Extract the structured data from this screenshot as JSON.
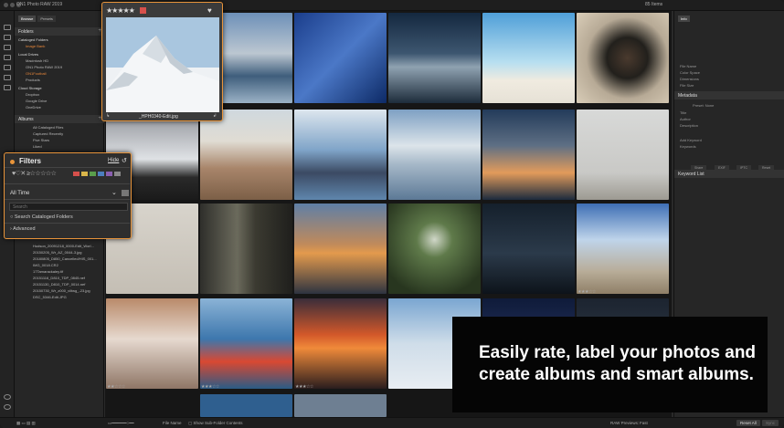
{
  "app": {
    "title": "ON1 Photo RAW 2019",
    "items_count": "85 Items"
  },
  "left": {
    "tabs": [
      "Browse",
      "Presets"
    ],
    "folders_title": "Folders",
    "cataloged_title": "Cataloged Folders",
    "cataloged_items": [
      "Image Bank"
    ],
    "local_title": "Local Drives",
    "local_items": [
      "Macintosh HD",
      "ON1 Photo RAW 2019",
      "ON1Football",
      "Products"
    ],
    "cloud_title": "Cloud Storage",
    "cloud_items": [
      "Dropbox",
      "Google Drive",
      "OneDrive"
    ],
    "albums_title": "Albums",
    "album_items": [
      "All Cataloged Files",
      "Captured Recently",
      "Five Stars",
      "Liked"
    ],
    "file_items": [
      "Hudson_20091218_0000-Edit_Worl...",
      "20150205_Wr_AZ_0044-3.jpg",
      "20180805_D850_Cancelled/HIS_001...",
      "IMG_0018.CR2",
      "17Tamarackaley.tif",
      "20151116_D810_TDP_0845.nef",
      "20151130_D810_TDP_0014.nef",
      "20150730_Wr_z000_viltwg_-23.jpg",
      "DSC_5346-Edit.JPG"
    ]
  },
  "popup": {
    "stars": "★★★★★",
    "filename": "_HPH0340-Edit.jpg",
    "heart": "♥"
  },
  "filters": {
    "title": "Filters",
    "hide": "Hide",
    "reset": "↺",
    "rating": "♥♡✕ ≥☆☆☆☆☆",
    "time": "All Time",
    "search_placeholder": "Search",
    "search_cataloged": "Search Cataloged Folders",
    "advanced": "Advanced"
  },
  "tile_stars": [
    "★★★☆☆",
    "★★☆☆☆",
    "★★★☆☆",
    "★★★☆☆"
  ],
  "right": {
    "tab": "Info",
    "info_rows": [
      "File Name",
      "Color Space",
      "Dimensions",
      "File Size"
    ],
    "metadata_title": "Metadata",
    "preset_label": "Preset: None",
    "meta_rows": [
      "Title",
      "Author",
      "Description",
      "Add Keyword",
      "Keywords"
    ],
    "buttons": [
      "Share",
      "EXIF",
      "IPTC",
      "Reset"
    ],
    "keyword_title": "Keyword List"
  },
  "bottom": {
    "file_name": "File Name",
    "show_sub": "Show Sub-Folder Contents",
    "raw_previews": "RAW Previews:",
    "raw_value": "Fast",
    "reset_all": "Reset All",
    "sync": "Sync"
  },
  "overlay": {
    "line1": "Easily rate, label your photos and",
    "line2": "create albums and smart albums."
  },
  "colors": {
    "accent": "#e8943a",
    "label_red": "#d6504b"
  }
}
